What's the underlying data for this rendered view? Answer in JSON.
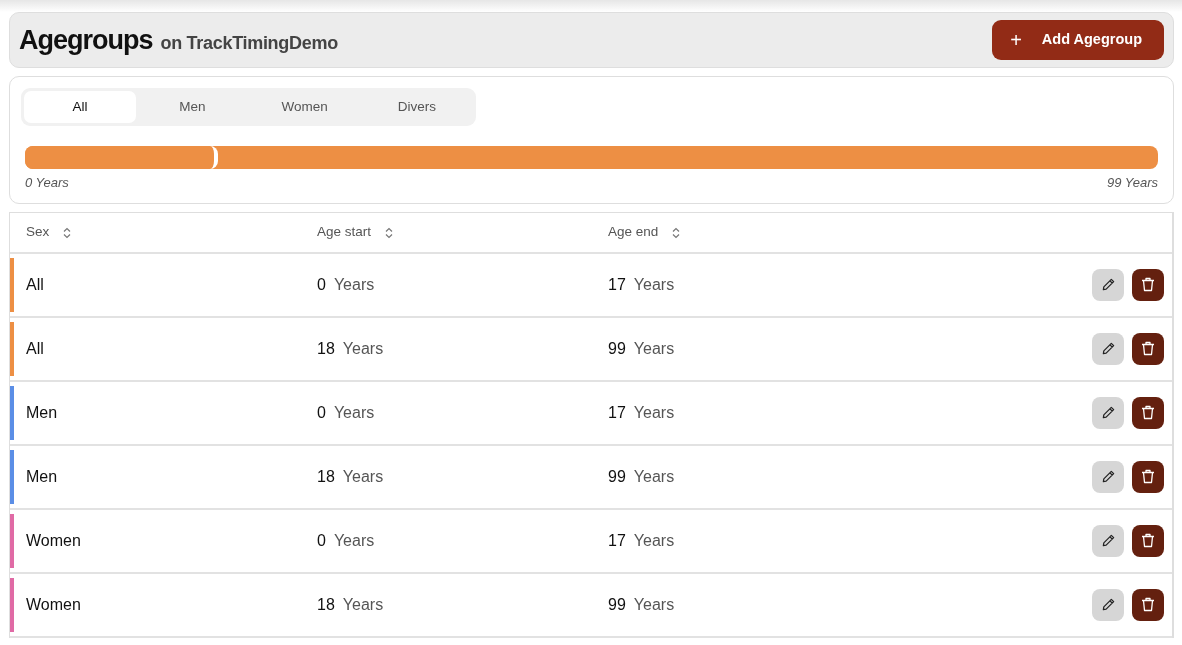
{
  "header": {
    "title": "Agegroups",
    "subtitle": "on TrackTimingDemo",
    "add_button": {
      "icon": "+",
      "label": "Add Agegroup"
    }
  },
  "filter_tabs": [
    {
      "label": "All",
      "selected": true
    },
    {
      "label": "Men",
      "selected": false
    },
    {
      "label": "Women",
      "selected": false
    },
    {
      "label": "Divers",
      "selected": false
    }
  ],
  "range_bar": {
    "level": 0.17,
    "min_label": "0 Years",
    "max_label": "99 Years"
  },
  "table": {
    "columns": [
      "Sex",
      "Age start",
      "Age end"
    ],
    "rows": [
      {
        "sex": "All",
        "color": "#ed8f44",
        "age_start": "0",
        "start_unit": "Years",
        "age_end": "17",
        "end_unit": "Years"
      },
      {
        "sex": "All",
        "color": "#ed8f44",
        "age_start": "18",
        "start_unit": "Years",
        "age_end": "99",
        "end_unit": "Years"
      },
      {
        "sex": "Men",
        "color": "#5b8ee6",
        "age_start": "0",
        "start_unit": "Years",
        "age_end": "17",
        "end_unit": "Years"
      },
      {
        "sex": "Men",
        "color": "#5b8ee6",
        "age_start": "18",
        "start_unit": "Years",
        "age_end": "99",
        "end_unit": "Years"
      },
      {
        "sex": "Women",
        "color": "#e06aa5",
        "age_start": "0",
        "start_unit": "Years",
        "age_end": "17",
        "end_unit": "Years"
      },
      {
        "sex": "Women",
        "color": "#e06aa5",
        "age_start": "18",
        "start_unit": "Years",
        "age_end": "99",
        "end_unit": "Years"
      }
    ]
  }
}
